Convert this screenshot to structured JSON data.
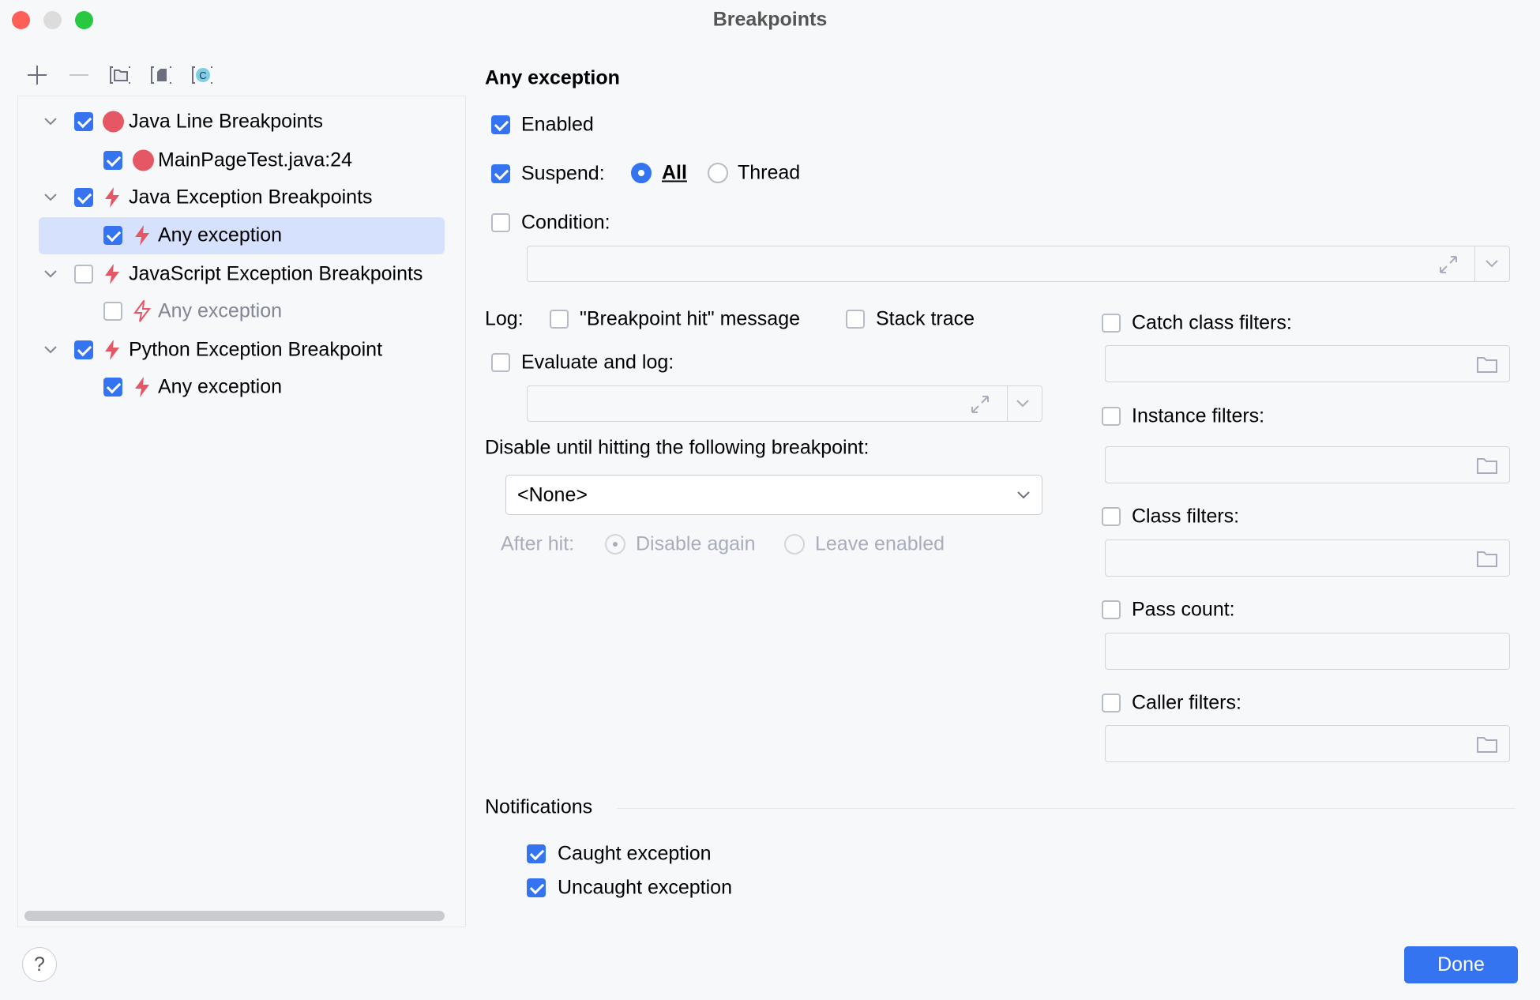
{
  "window": {
    "title": "Breakpoints"
  },
  "toolbar": {
    "icons": [
      "add-icon",
      "remove-icon",
      "group-by-folder-icon",
      "group-by-file-icon",
      "group-by-class-icon"
    ],
    "class_glyph": "C"
  },
  "tree": {
    "items": [
      {
        "label": "Java Line Breakpoints",
        "checked": true,
        "icon": "red-dot",
        "level": 0
      },
      {
        "label": "MainPageTest.java:24",
        "checked": true,
        "icon": "red-dot",
        "level": 1
      },
      {
        "label": "Java Exception Breakpoints",
        "checked": true,
        "icon": "bolt",
        "level": 0
      },
      {
        "label": "Any exception",
        "checked": true,
        "icon": "bolt",
        "level": 1,
        "selected": true
      },
      {
        "label": "JavaScript Exception Breakpoints",
        "checked": false,
        "icon": "bolt",
        "level": 0
      },
      {
        "label": "Any exception",
        "checked": false,
        "icon": "bolt",
        "level": 1,
        "disabled": true
      },
      {
        "label": "Python Exception Breakpoint",
        "checked": true,
        "icon": "bolt",
        "level": 0
      },
      {
        "label": "Any exception",
        "checked": true,
        "icon": "bolt",
        "level": 1
      }
    ]
  },
  "detail": {
    "heading": "Any exception",
    "enabled": "Enabled",
    "suspend": "Suspend:",
    "suspend_all": "All",
    "suspend_thread": "Thread",
    "condition": "Condition:",
    "log": "Log:",
    "log_message": "\"Breakpoint hit\" message",
    "stack_trace": "Stack trace",
    "evaluate_and_log": "Evaluate and log:",
    "disable_until": "Disable until hitting the following breakpoint:",
    "disable_until_value": "<None>",
    "after_hit": "After hit:",
    "disable_again": "Disable again",
    "leave_enabled": "Leave enabled",
    "catch_filters": "Catch class filters:",
    "instance_filters": "Instance filters:",
    "class_filters": "Class filters:",
    "pass_count": "Pass count:",
    "caller_filters": "Caller filters:",
    "notifications": "Notifications",
    "caught": "Caught exception",
    "uncaught": "Uncaught exception"
  },
  "footer": {
    "help": "?",
    "done": "Done"
  },
  "colors": {
    "accent": "#3574f0",
    "breakpoint": "#e55765",
    "selection": "#d5e1fd"
  }
}
